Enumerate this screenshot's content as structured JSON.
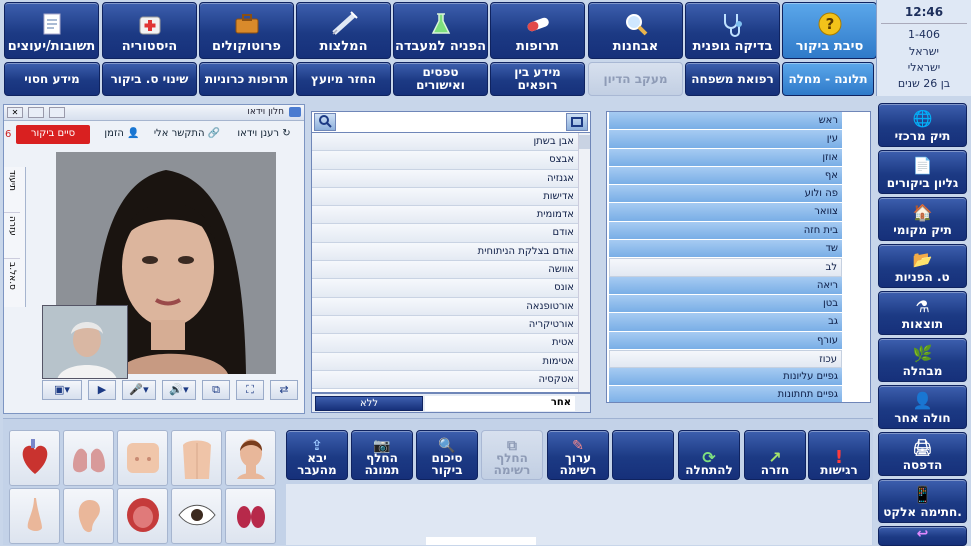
{
  "top_toolbar": [
    {
      "label": "סיבת ביקור",
      "icon": "question-icon",
      "selected": true
    },
    {
      "label": "בדיקה גופנית",
      "icon": "stethoscope-icon"
    },
    {
      "label": "אבחנות",
      "icon": "magnifier-icon"
    },
    {
      "label": "תרופות",
      "icon": "pill-icon"
    },
    {
      "label": "הפניה למעבדה",
      "icon": "flask-icon"
    },
    {
      "label": "המלצות",
      "icon": "syringe-icon"
    },
    {
      "label": "פרוטוקולים",
      "icon": "briefcase-icon"
    },
    {
      "label": "היסטוריה",
      "icon": "medical-kit-icon"
    },
    {
      "label": "תשובות/יעוצים",
      "icon": "notepad-icon"
    }
  ],
  "second_row": [
    {
      "label": "תלונה - מחלה",
      "selected": true
    },
    {
      "label": "רפואת משפחה"
    },
    {
      "label": "מעקב הדיון",
      "disabled": true
    },
    {
      "label": "מידע בין רופאים"
    },
    {
      "label": "טפסים ואישורים"
    },
    {
      "label": "החזר מיועץ"
    },
    {
      "label": "תרופות כרוניות"
    },
    {
      "label": "שינוי ס. ביקור"
    },
    {
      "label": "מידע חסוי"
    }
  ],
  "header_info": {
    "time": "12:46",
    "id": "1-406",
    "line1": "ישראל",
    "line2": "ישראלי",
    "age": "בן 26 שנים"
  },
  "right_nav": [
    {
      "label": "תיק מרכזי",
      "icon": "globe-icon"
    },
    {
      "label": "גליון ביקורים",
      "icon": "document-icon"
    },
    {
      "label": "תיק מקומי",
      "icon": "house-icon"
    },
    {
      "label": "ט. הפניות",
      "icon": "folder-icon"
    },
    {
      "label": "תוצאות",
      "icon": "flask-icon"
    },
    {
      "label": "מבהלה",
      "icon": "leaf-icon"
    },
    {
      "label": "חולה אחר",
      "icon": "person-icon"
    },
    {
      "label": "הדפסה",
      "icon": "printer-icon"
    },
    {
      "label": "חתימה אלקט.",
      "icon": "tablet-icon"
    }
  ],
  "body_parts": [
    "ראש",
    "עין",
    "אוזן",
    "אף",
    "פה ולוע",
    "צוואר",
    "בית חזה",
    "שד",
    "לב",
    "ריאה",
    "בטן",
    "גב",
    "עורף",
    "עכוז",
    "גפיים עליונות",
    "גפיים תחתונות"
  ],
  "body_parts_selected": [
    "לב",
    "עכוז"
  ],
  "complaints": [
    "אבן בשתן",
    "אבצס",
    "אגנזיה",
    "אדישות",
    "אדמומית",
    "אודם",
    "אודם בצלקת הניתוחית",
    "אוושה",
    "אונס",
    "אורטופנאה",
    "אורטיקריה",
    "אטית",
    "אטימות",
    "אטקסיה"
  ],
  "search": {
    "value": ""
  },
  "footer_mid": {
    "other_label": "אחר",
    "none_label": "ללא"
  },
  "video_panel": {
    "window_title": "חלון וידאו",
    "refresh_label": "רענן וידאו",
    "call_me_label": "התקשר אלי",
    "invite_label": "הזמן",
    "end_visit_label": "סיים ביקור",
    "left_number": "6",
    "side_tabs": [
      "תיעוד",
      "עזרה",
      "ס.אל.ב"
    ]
  },
  "action_buttons": [
    {
      "label": "רגישות",
      "icon": "alert-icon"
    },
    {
      "label": "חזרה",
      "icon": "arrow-up-icon"
    },
    {
      "label": "להתחלה",
      "icon": "refresh-icon"
    },
    {
      "label": "",
      "icon": ""
    },
    {
      "label": "ערוך רשימה",
      "icon": "pencil-icon"
    },
    {
      "label": "החלף רשימה",
      "icon": "swap-icon",
      "disabled": true
    },
    {
      "label": "סיכום ביקור",
      "icon": "search-doc-icon"
    },
    {
      "label": "החלף תמונה",
      "icon": "camera-icon"
    },
    {
      "label": "יבא מהעבר",
      "icon": "import-icon"
    }
  ],
  "body_icons": [
    "head-icon",
    "torso-back-icon",
    "chest-icon",
    "lungs-icon",
    "heart-icon",
    "kidney-icon",
    "eye-icon",
    "mouth-icon",
    "ear-icon",
    "nose-icon"
  ]
}
